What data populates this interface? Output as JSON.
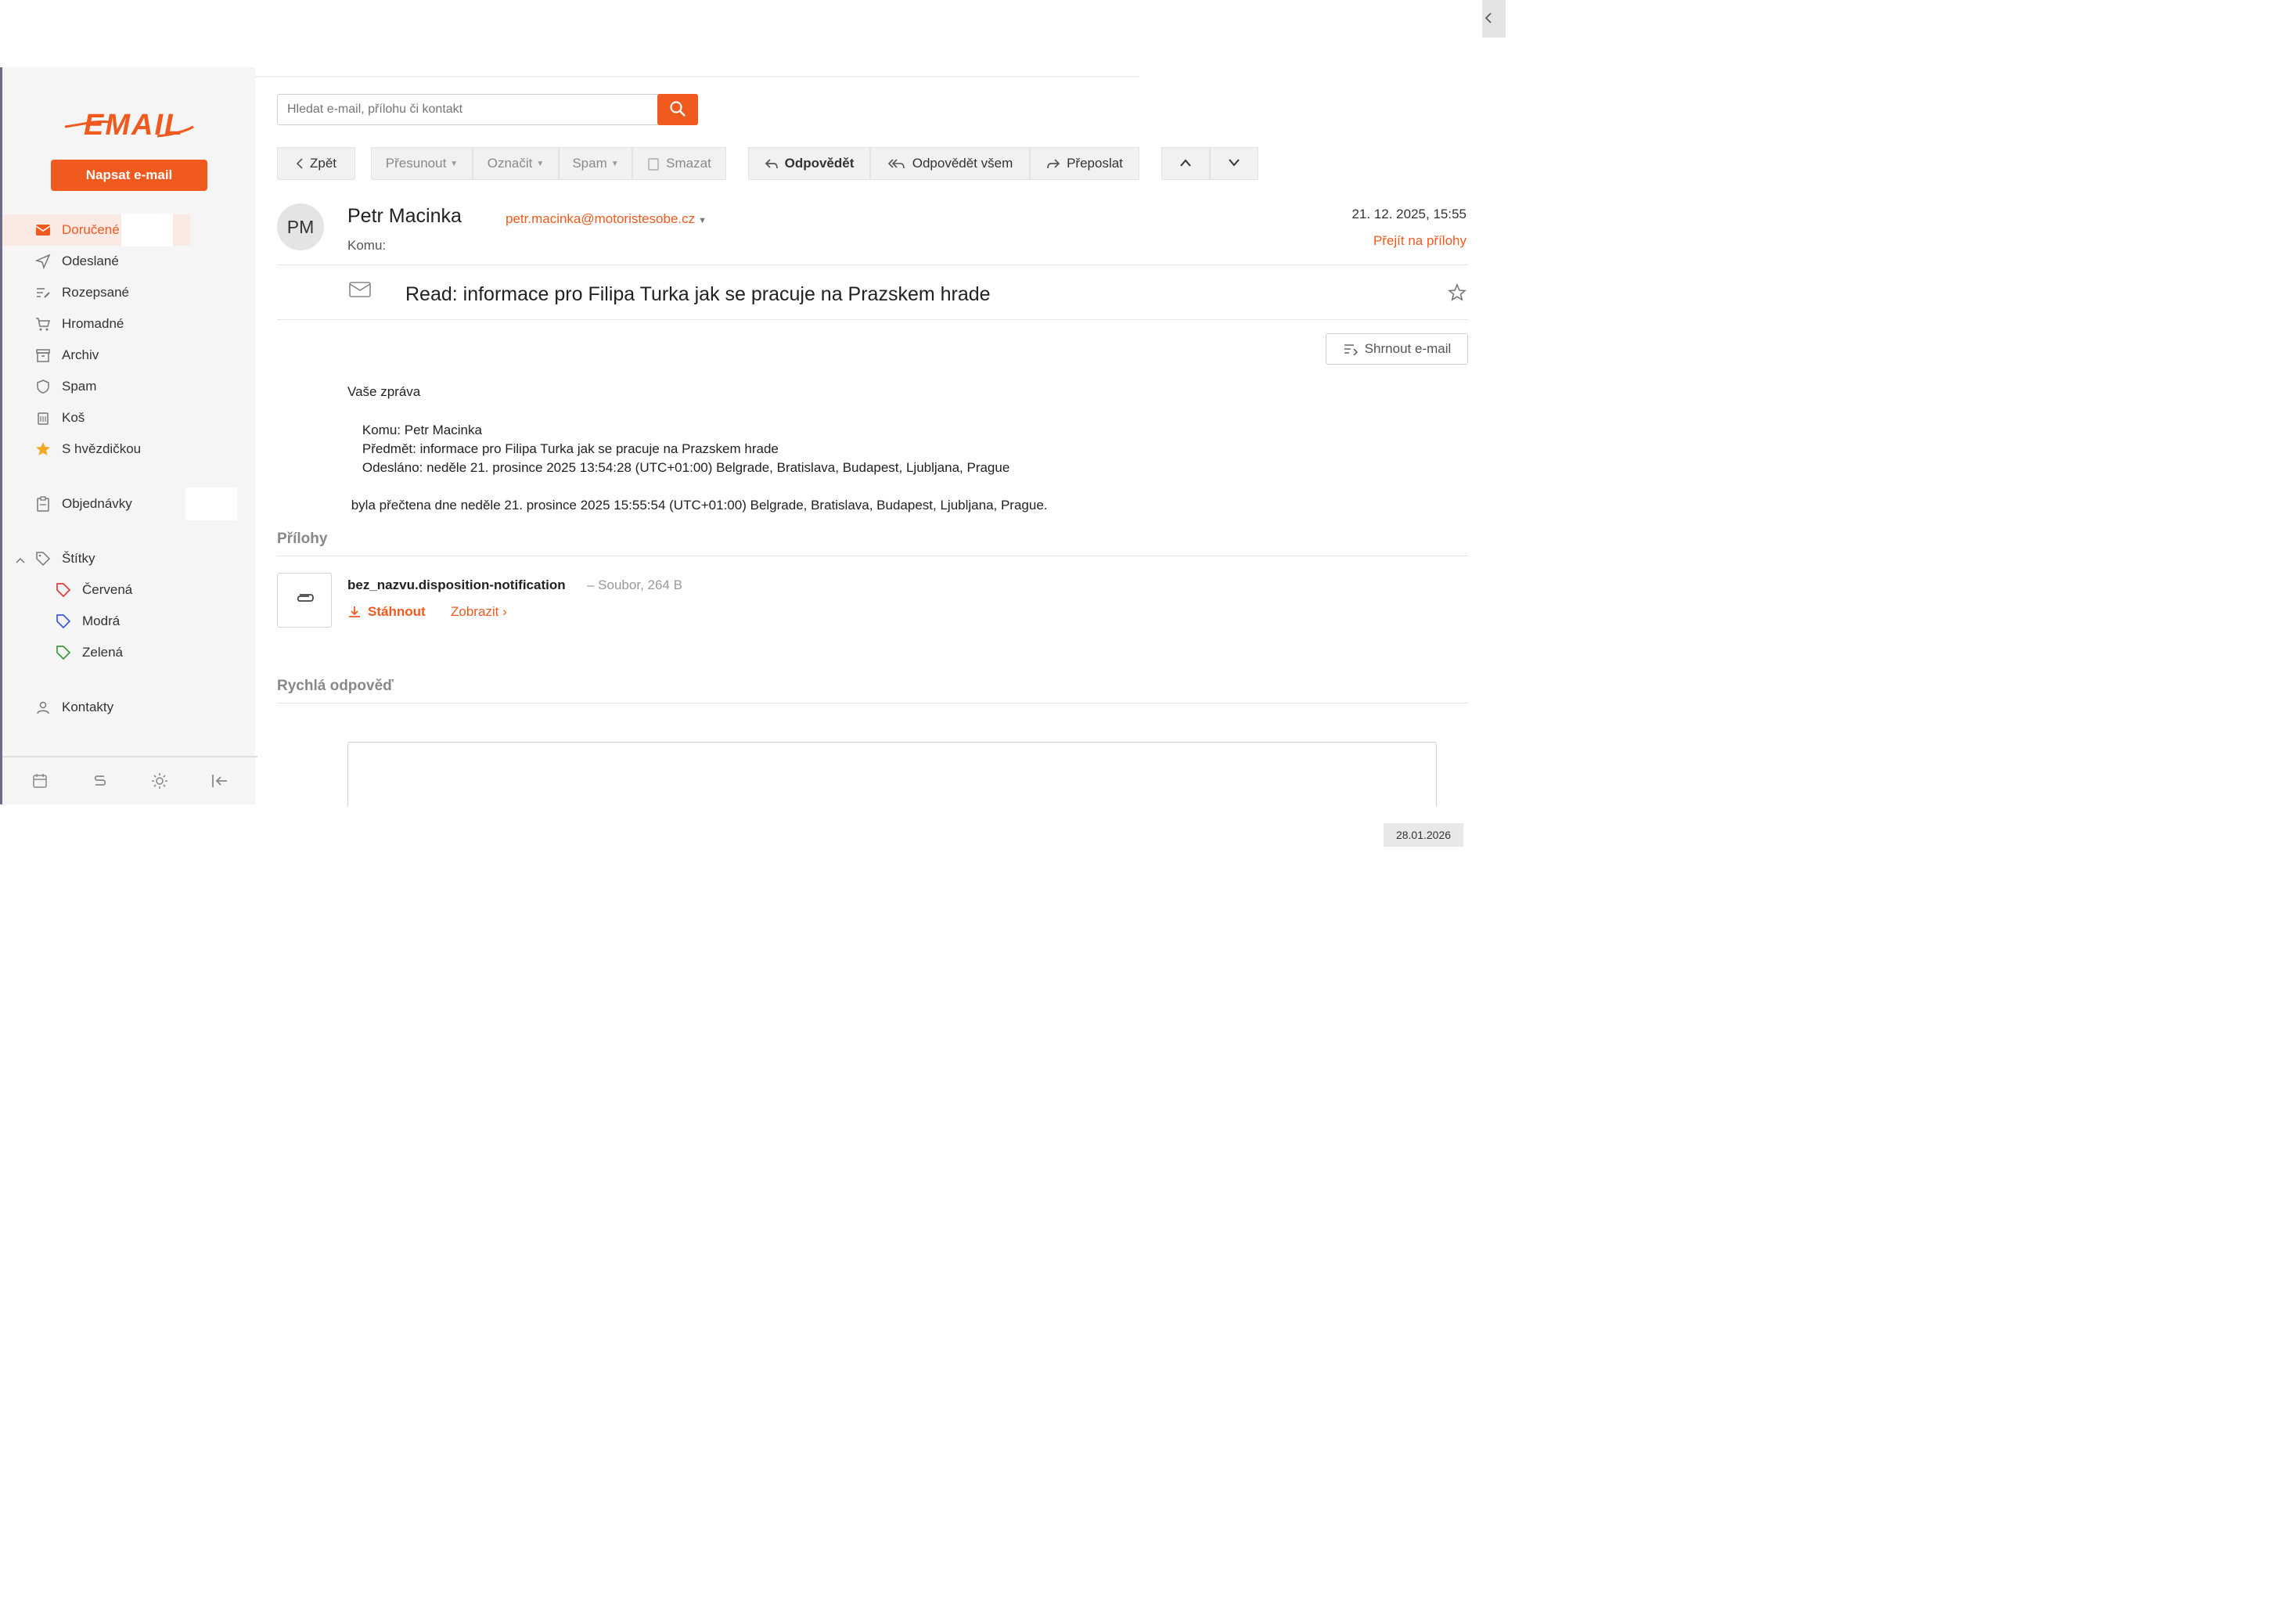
{
  "app": {
    "logo_text": "EMAIL",
    "accent_color": "#f05a1e"
  },
  "sidebar": {
    "compose_label": "Napsat e-mail",
    "items": [
      {
        "label": "Doručené",
        "icon": "inbox-icon",
        "active": true
      },
      {
        "label": "Odeslané",
        "icon": "send-icon"
      },
      {
        "label": "Rozepsané",
        "icon": "drafts-icon"
      },
      {
        "label": "Hromadné",
        "icon": "cart-icon"
      },
      {
        "label": "Archiv",
        "icon": "archive-icon"
      },
      {
        "label": "Spam",
        "icon": "shield-icon"
      },
      {
        "label": "Koš",
        "icon": "trash-icon"
      },
      {
        "label": "S hvězdičkou",
        "icon": "star-icon"
      }
    ],
    "orders_label": "Objednávky",
    "labels_label": "Štítky",
    "labels": [
      {
        "label": "Červená",
        "color": "#e03a3a"
      },
      {
        "label": "Modrá",
        "color": "#3a5ae0"
      },
      {
        "label": "Zelená",
        "color": "#3a9a3a"
      }
    ],
    "contacts_label": "Kontakty",
    "bottom_icons": [
      "calendar-icon",
      "swap-icon",
      "settings-icon",
      "collapse-sidebar-icon"
    ]
  },
  "search": {
    "placeholder": "Hledat e-mail, přílohu či kontakt"
  },
  "toolbar": {
    "back": "Zpět",
    "move": "Přesunout",
    "mark": "Označit",
    "spam": "Spam",
    "delete": "Smazat",
    "reply": "Odpovědět",
    "reply_all": "Odpovědět všem",
    "forward": "Přeposlat"
  },
  "message": {
    "avatar_initials": "PM",
    "sender_name": "Petr Macinka",
    "sender_email": "petr.macinka@motoristesobe.cz",
    "to_label": "Komu:",
    "date": "21. 12. 2025, 15:55",
    "goto_attachments": "Přejít na přílohy",
    "subject": "Read: informace pro Filipa Turka jak se pracuje na Prazskem hrade",
    "summarize": "Shrnout e-mail",
    "body": {
      "line1": "Vaše zpráva",
      "line2": "    Komu: Petr Macinka",
      "line3": "    Předmět: informace pro Filipa Turka jak se pracuje na Prazskem hrade",
      "line4": "    Odesláno: neděle 21. prosince 2025 13:54:28 (UTC+01:00) Belgrade, Bratislava, Budapest, Ljubljana, Prague",
      "line5": " byla přečtena dne neděle 21. prosince 2025 15:55:54 (UTC+01:00) Belgrade, Bratislava, Budapest, Ljubljana, Prague."
    }
  },
  "attachments": {
    "title": "Přílohy",
    "items": [
      {
        "name": "bez_nazvu.disposition-notification",
        "meta": "– Soubor, 264 B",
        "download": "Stáhnout",
        "view": "Zobrazit ›"
      }
    ]
  },
  "quick_reply": {
    "title": "Rychlá odpověď"
  },
  "footer": {
    "date_badge": "28.01.2026"
  }
}
